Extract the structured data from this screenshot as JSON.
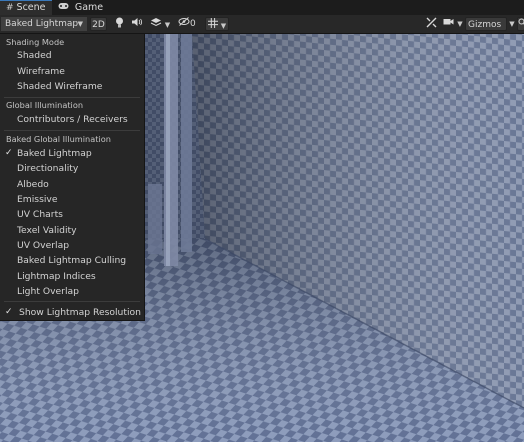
{
  "tabs": [
    {
      "label": "Scene",
      "icon": "grid-icon",
      "active": true
    },
    {
      "label": "Game",
      "icon": "gamepad-icon",
      "active": false
    }
  ],
  "toolbar": {
    "draw_mode": "Baked Lightmap",
    "mode_2d": "2D",
    "hidden_count": "0",
    "gizmos": "Gizmos"
  },
  "menu": {
    "shading_mode": {
      "header": "Shading Mode",
      "items": [
        "Shaded",
        "Wireframe",
        "Shaded Wireframe"
      ]
    },
    "global_illumination": {
      "header": "Global Illumination",
      "items": [
        "Contributors / Receivers"
      ]
    },
    "baked_gi": {
      "header": "Baked Global Illumination",
      "items": [
        "Baked Lightmap",
        "Directionality",
        "Albedo",
        "Emissive",
        "UV Charts",
        "Texel Validity",
        "UV Overlap",
        "Baked Lightmap Culling",
        "Lightmap Indices",
        "Light Overlap"
      ],
      "checked": "Baked Lightmap"
    },
    "toggle": {
      "label": "Show Lightmap Resolution",
      "checked": true
    }
  },
  "colors": {
    "accent": "#3a79bb",
    "menu_bg": "#262626",
    "checker_light": "#8a9ab8",
    "checker_dark": "#4f5f82"
  }
}
